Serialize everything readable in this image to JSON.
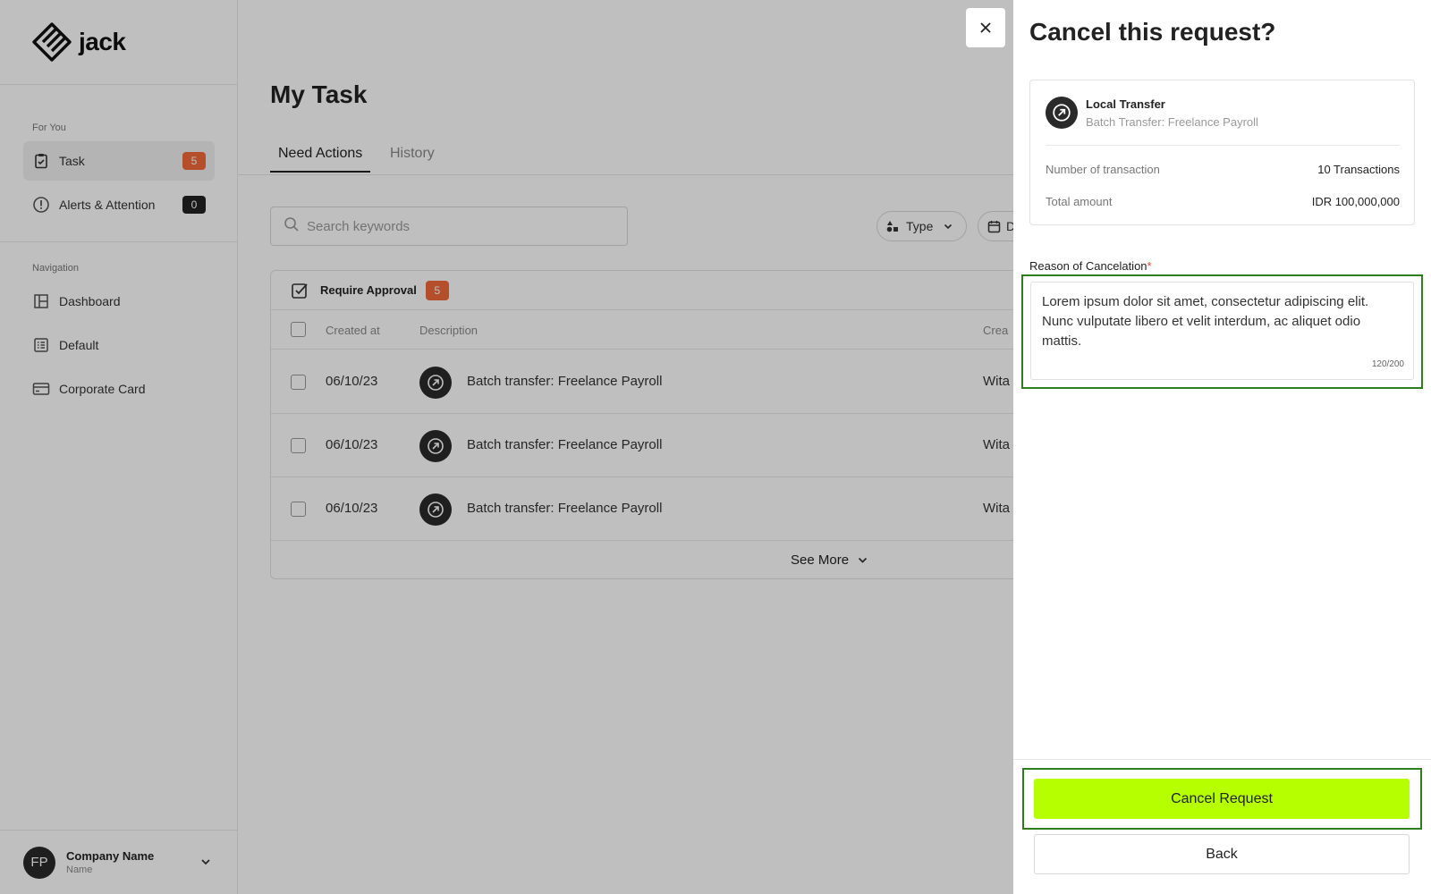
{
  "app": {
    "logo_text": "jack"
  },
  "sidebar": {
    "for_you_label": "For You",
    "navigation_label": "Navigation",
    "task": {
      "label": "Task",
      "count": "5",
      "icon": "clipboard-check-icon"
    },
    "alerts": {
      "label": "Alerts & Attention",
      "count": "0",
      "icon": "alert-circle-icon"
    },
    "nav": [
      {
        "label": "Dashboard",
        "icon": "layout-icon"
      },
      {
        "label": "Default",
        "icon": "list-icon"
      },
      {
        "label": "Corporate Card",
        "icon": "credit-card-icon"
      }
    ],
    "company": {
      "initials": "FP",
      "name": "Company Name",
      "sub": "Name"
    }
  },
  "main": {
    "title": "My Task",
    "tabs": [
      {
        "label": "Need Actions"
      },
      {
        "label": "History"
      }
    ],
    "search_placeholder": "Search keywords",
    "filters": {
      "type_label": "Type",
      "date_label": "D"
    },
    "table": {
      "group_label": "Require Approval",
      "group_count": "5",
      "columns": {
        "created_at": "Created at",
        "description": "Description",
        "creator": "Crea"
      },
      "rows": [
        {
          "date": "06/10/23",
          "description": "Batch transfer: Freelance Payroll",
          "creator": "Wita"
        },
        {
          "date": "06/10/23",
          "description": "Batch transfer: Freelance Payroll",
          "creator": "Wita"
        },
        {
          "date": "06/10/23",
          "description": "Batch transfer: Freelance Payroll",
          "creator": "Wita"
        }
      ],
      "see_more": "See More"
    }
  },
  "panel": {
    "title": "Cancel this request?",
    "card": {
      "title": "Local Transfer",
      "subtitle": "Batch Transfer: Freelance Payroll",
      "num_tx_label": "Number of transaction",
      "num_tx_value": "10 Transactions",
      "total_label": "Total amount",
      "total_value": "IDR 100,000,000"
    },
    "reason": {
      "label": "Reason of Cancelation",
      "required_mark": "*",
      "value": "Lorem ipsum dolor sit amet, consectetur adipiscing elit. Nunc vulputate libero et velit interdum, ac aliquet odio mattis.",
      "counter": "120/200"
    },
    "cancel_button": "Cancel Request",
    "back_button": "Back"
  },
  "colors": {
    "accent": "#b5ff00",
    "badge": "#f26a3a",
    "highlight": "#2e7d1e"
  }
}
